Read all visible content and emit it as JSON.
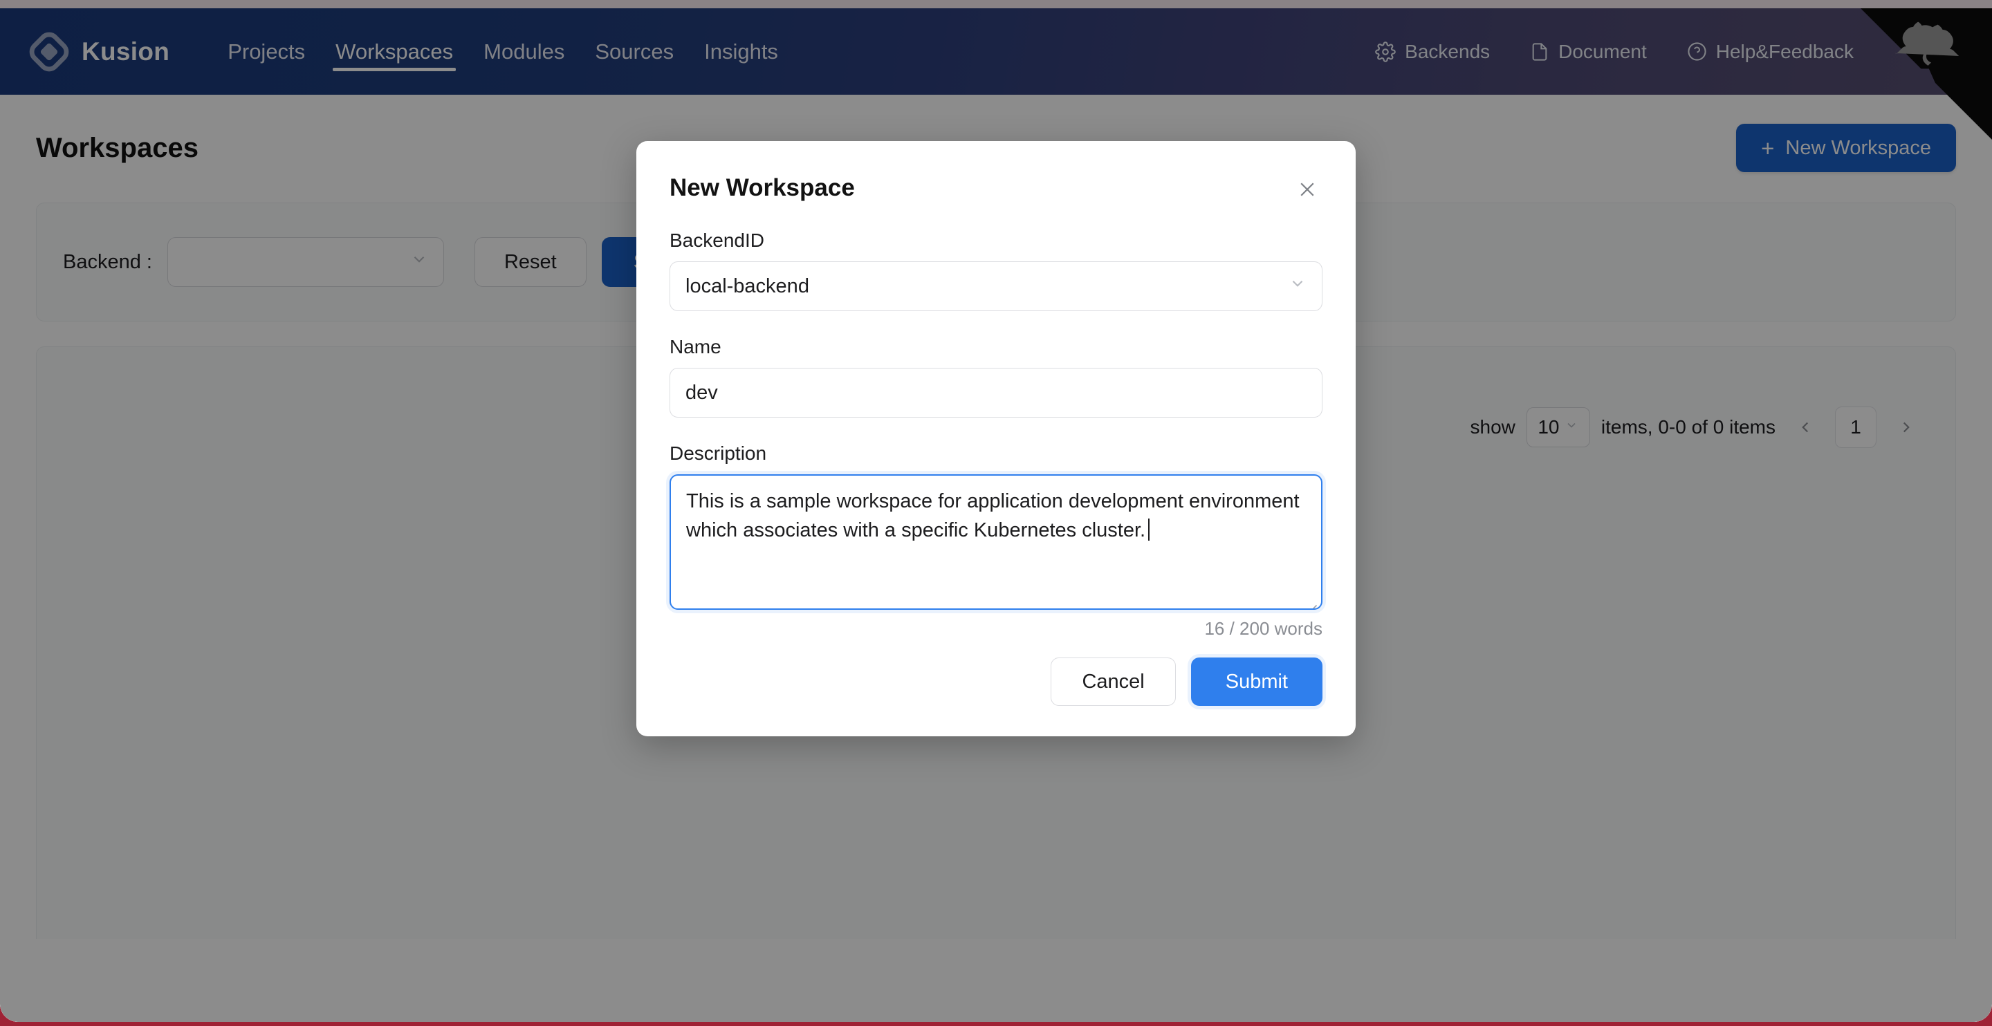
{
  "brand": {
    "name": "Kusion",
    "logo_icon": "kusion-diamond-logo"
  },
  "nav": {
    "primary": [
      {
        "label": "Projects",
        "active": false
      },
      {
        "label": "Workspaces",
        "active": true
      },
      {
        "label": "Modules",
        "active": false
      },
      {
        "label": "Sources",
        "active": false
      },
      {
        "label": "Insights",
        "active": false
      }
    ],
    "utilities": [
      {
        "label": "Backends",
        "icon": "gear-icon"
      },
      {
        "label": "Document",
        "icon": "file-icon"
      },
      {
        "label": "Help&Feedback",
        "icon": "question-circle-icon"
      }
    ],
    "corner_icon": "github-octocat-corner",
    "gradient_from": "#1b3a7c",
    "gradient_to": "#585071"
  },
  "page": {
    "title": "Workspaces",
    "new_workspace_label": "New Workspace",
    "new_workspace_icon": "plus-icon",
    "accent_color": "#1b61c9"
  },
  "filter": {
    "backend_label": "Backend :",
    "backend_value": "",
    "backend_placeholder": "",
    "reset_label": "Reset",
    "search_label": "Search",
    "caret_icon": "chevron-down-icon"
  },
  "pagination": {
    "show_label": "show",
    "page_size": "10",
    "items_label": "items, 0-0 of 0 items",
    "prev_icon": "chevron-left-icon",
    "next_icon": "chevron-right-icon",
    "current_page": "1"
  },
  "modal": {
    "title": "New Workspace",
    "close_icon": "close-icon",
    "fields": {
      "backend_id": {
        "label": "BackendID",
        "value": "local-backend",
        "caret_icon": "chevron-down-icon"
      },
      "name": {
        "label": "Name",
        "value": "dev",
        "placeholder": ""
      },
      "description": {
        "label": "Description",
        "value": "This is a sample workspace for application development environment which associates with a specific Kubernetes cluster.",
        "placeholder": "",
        "word_count": "16 / 200 words",
        "resize_icon": "resize-grip-icon",
        "focus_color": "#2f7fed"
      }
    },
    "cancel_label": "Cancel",
    "submit_label": "Submit",
    "submit_color": "#2f7fed"
  }
}
